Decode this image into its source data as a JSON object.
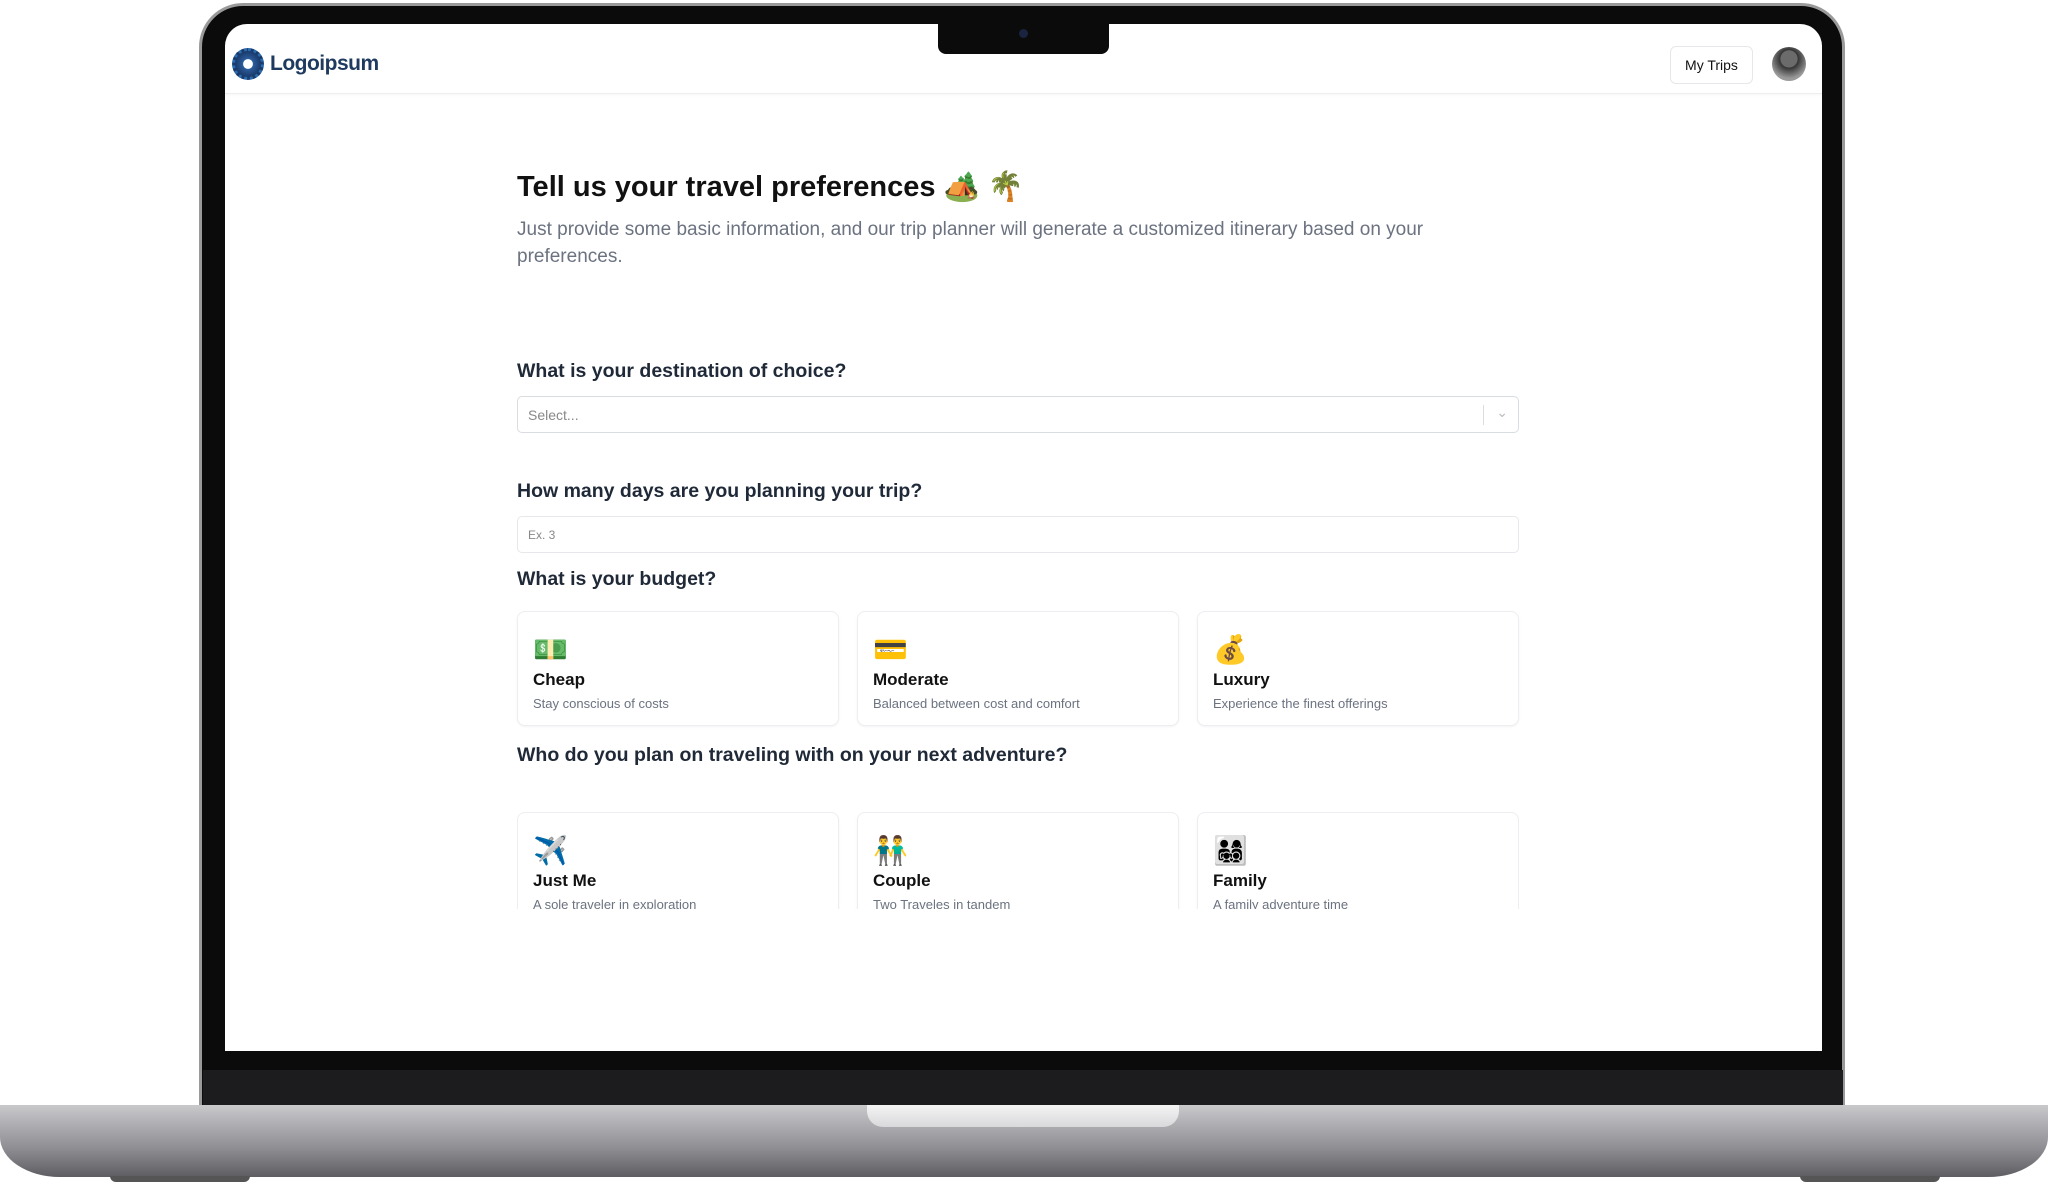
{
  "header": {
    "logo_text": "Logoipsum",
    "my_trips_label": "My Trips"
  },
  "page": {
    "title": "Tell us your travel preferences 🏕️ 🌴",
    "subtitle": "Just provide some basic information, and our trip planner will generate a customized itinerary based on your preferences."
  },
  "destination": {
    "question": "What is your destination of choice?",
    "placeholder": "Select..."
  },
  "days": {
    "question": "How many days are you planning your trip?",
    "placeholder": "Ex. 3"
  },
  "budget": {
    "question": "What is your budget?",
    "options": [
      {
        "icon": "💵",
        "label": "Cheap",
        "desc": "Stay conscious of costs"
      },
      {
        "icon": "💳",
        "label": "Moderate",
        "desc": "Balanced between cost and comfort"
      },
      {
        "icon": "💰",
        "label": "Luxury",
        "desc": "Experience the finest offerings"
      }
    ]
  },
  "travelers": {
    "question": "Who do you plan on traveling with on your next adventure?",
    "options": [
      {
        "icon": "✈️",
        "label": "Just Me",
        "desc": "A sole traveler in exploration"
      },
      {
        "icon": "👬",
        "label": "Couple",
        "desc": "Two Traveles in tandem"
      },
      {
        "icon": "👨‍👩‍👧‍👦",
        "label": "Family",
        "desc": "A family adventure time"
      }
    ]
  }
}
